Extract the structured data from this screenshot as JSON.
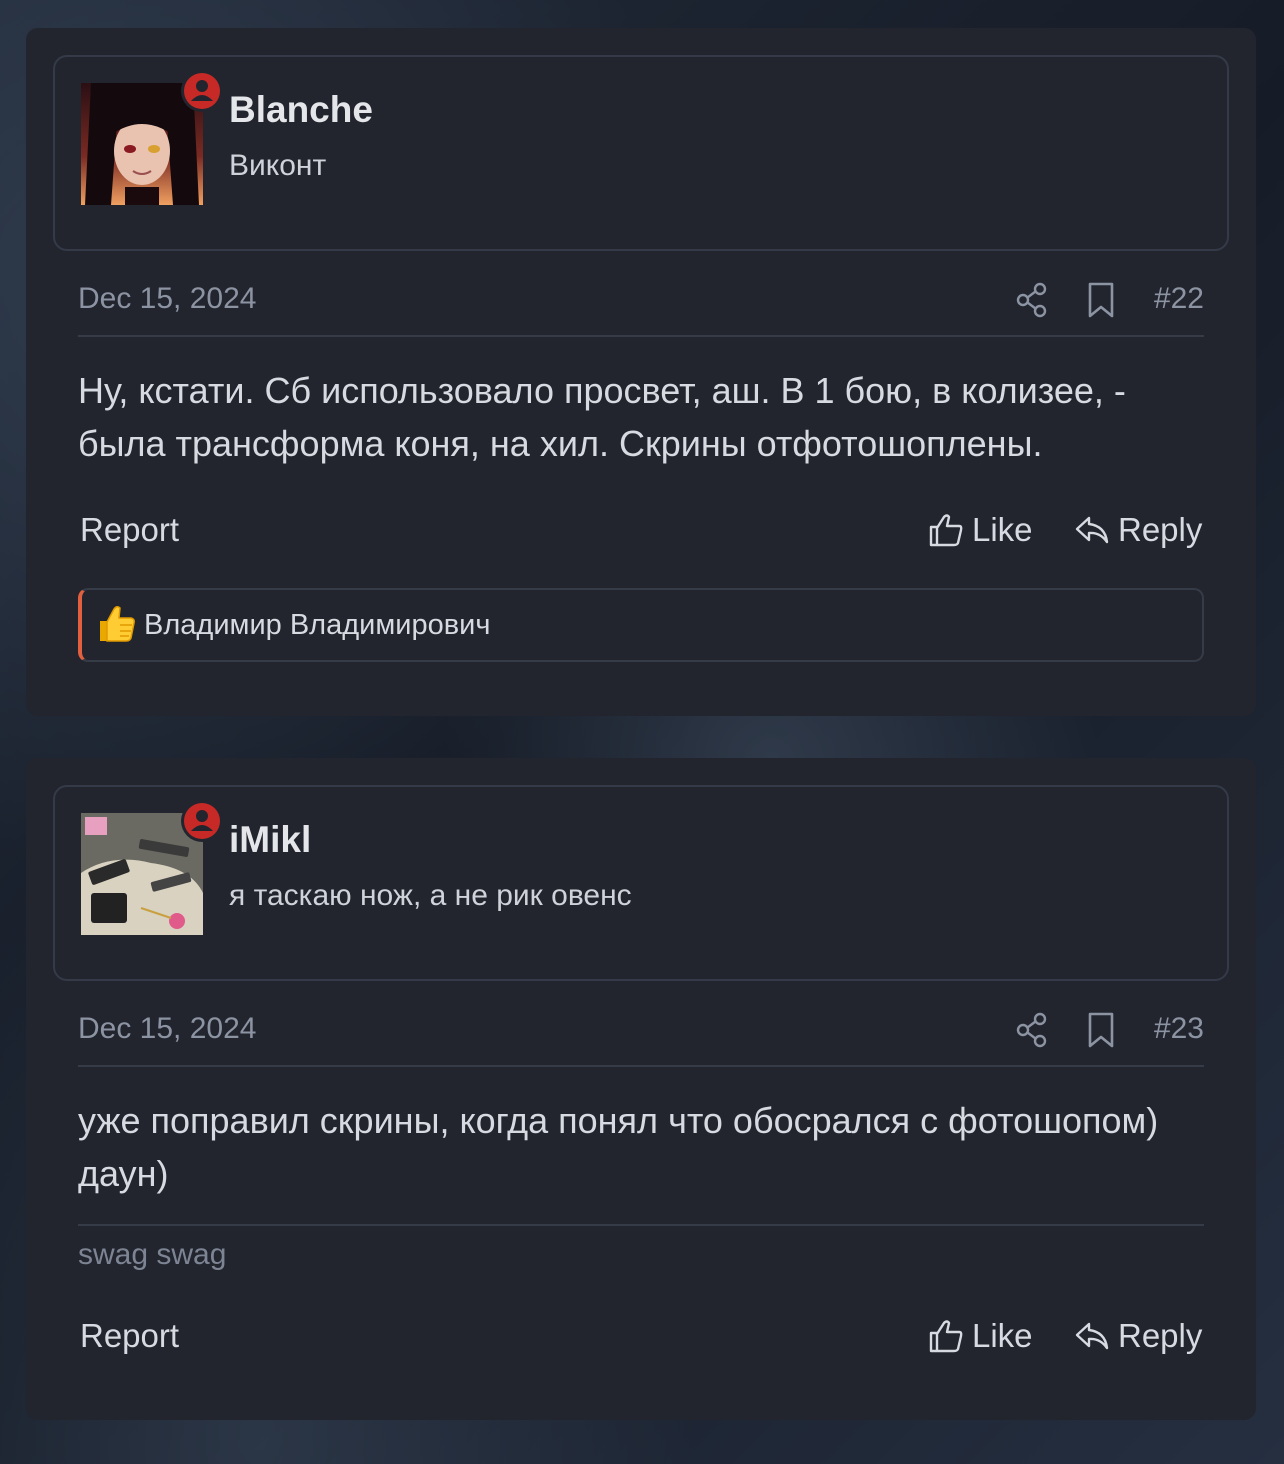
{
  "posts": [
    {
      "username": "Blanche",
      "user_title": "Виконт",
      "date": "Dec 15, 2024",
      "number": "#22",
      "body": "Ну, кстати. Сб использовало просвет, аш. В 1 бою, в колизее, - была трансформа коня, на хил. Скрины отфотошоплены.",
      "actions": {
        "report": "Report",
        "like": "Like",
        "reply": "Reply"
      },
      "reactions": {
        "icon": "thumbs-up-emoji",
        "users": "Владимир Владимирович"
      }
    },
    {
      "username": "iMikl",
      "user_title": "я таскаю нож, а не рик овенс",
      "date": "Dec 15, 2024",
      "number": "#23",
      "body": "уже поправил скрины, когда понял что обосрался с фотошопом) даун)",
      "signature": "swag swag",
      "actions": {
        "report": "Report",
        "like": "Like",
        "reply": "Reply"
      }
    }
  ],
  "colors": {
    "background": "#1b2230",
    "card": "#22252e",
    "border": "#343a48",
    "text": "#d7dae0",
    "muted": "#8c93a2",
    "online_badge": "#c72a26",
    "reaction_accent": "#e0603f"
  }
}
